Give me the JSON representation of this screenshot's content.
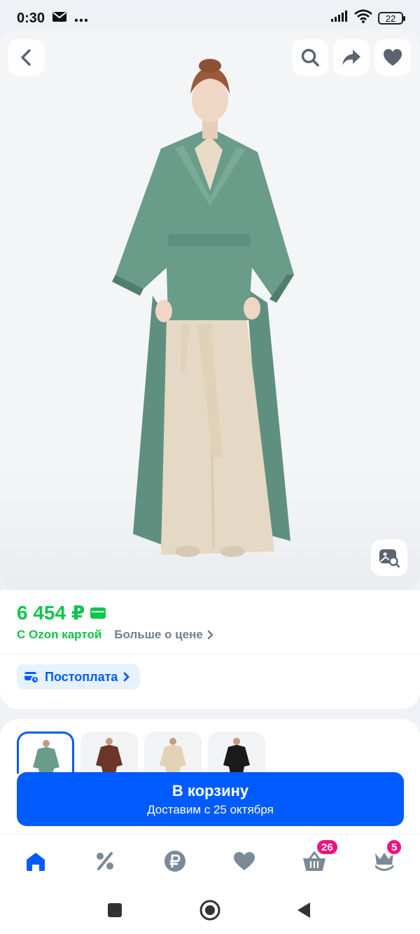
{
  "status": {
    "time": "0:30",
    "battery": "22"
  },
  "product": {
    "price": "6 454 ₽",
    "ozon_card_label": "С Ozon картой",
    "more_price_label": "Больше о цене",
    "postpay_label": "Постоплата"
  },
  "cart": {
    "button_label": "В корзину",
    "delivery_text": "Доставим с 25 октября"
  },
  "nav": {
    "cart_badge": "26",
    "profile_badge": "5"
  },
  "colors": {
    "accent": "#005bff",
    "price_green": "#10c44c",
    "badge_pink": "#f1117e"
  }
}
